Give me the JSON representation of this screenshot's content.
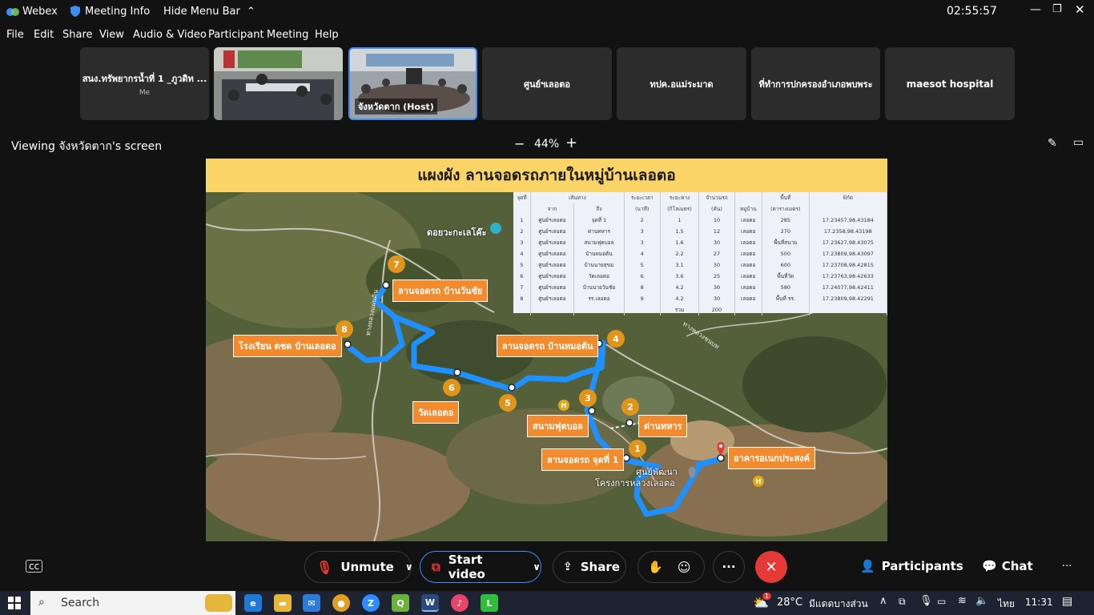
{
  "titlebar": {
    "app_name": "Webex",
    "meeting_info": "Meeting Info",
    "hide_menu": "Hide Menu Bar",
    "clock": "02:55:57"
  },
  "menu": [
    "File",
    "Edit",
    "Share",
    "View",
    "Audio & Video",
    "Participant",
    "Meeting",
    "Help"
  ],
  "participants": [
    {
      "name": "สนง.ทรัพยากรน้ำที่ 1 _ภูวดิท ...",
      "sub": "Me",
      "video": false
    },
    {
      "name": "",
      "sub": "",
      "video": true
    },
    {
      "name": "จังหวัดตาก (Host)",
      "sub": "",
      "video": true
    },
    {
      "name": "ศูนย์ฯเลอตอ",
      "sub": "",
      "video": false
    },
    {
      "name": "ทปค.อแม่ระมาด",
      "sub": "",
      "video": false
    },
    {
      "name": "ที่ทำการปกครองอำเภอพบพระ",
      "sub": "",
      "video": false
    },
    {
      "name": "maesot hospital",
      "sub": "",
      "video": false
    }
  ],
  "viewing": {
    "text": "Viewing จังหวัดตาก's screen",
    "zoom": "44%",
    "minus": "−",
    "plus": "+"
  },
  "slide": {
    "title": "แผงผัง ลานจอดรถภายในหมู่บ้านเลอตอ",
    "place_label": "ดอยวะกะเลโค๊ะ",
    "road_labels": [
      "ทางหลวงแผ่นดิน",
      "ทางหลวงชนบท"
    ],
    "table": {
      "headers": [
        "จุดที่",
        "เส้นทาง",
        "ระยะเวลา",
        "ระยะทาง",
        "จำนวนรถ",
        "หมู่บ้าน",
        "พื้นที่",
        "พิกัด"
      ],
      "subheaders": [
        "",
        "จาก",
        "ถึง",
        "(นาที)",
        "(กิโลเมตร)",
        "(คัน)",
        "",
        "(ตารางเมตร)",
        ""
      ],
      "rows": [
        [
          "1",
          "ศูนย์ฯเลอตอ",
          "จุดที่ 1",
          "2",
          "1",
          "10",
          "เลอตอ",
          "285",
          "17.23457,98.43184"
        ],
        [
          "2",
          "ศูนย์ฯเลอตอ",
          "ด่านทหาร",
          "3",
          "1.5",
          "12",
          "เลอตอ",
          "270",
          "17.2358,98.43198"
        ],
        [
          "3",
          "ศูนย์ฯเลอตอ",
          "สนามฟุตบอล",
          "3",
          "1.6",
          "30",
          "เลอตอ",
          "พื้นที่สนาม",
          "17.23627,98.43075"
        ],
        [
          "4",
          "ศูนย์ฯเลอตอ",
          "บ้านหมอต้น",
          "4",
          "2.2",
          "27",
          "เลอตอ",
          "500",
          "17.23809,98.43097"
        ],
        [
          "5",
          "ศูนย์ฯเลอตอ",
          "บ้านนายสุขม",
          "5",
          "3.1",
          "30",
          "เลอตอ",
          "600",
          "17.23708,98.42815"
        ],
        [
          "6",
          "ศูนย์ฯเลอตอ",
          "วัดเลอตอ",
          "6",
          "3.6",
          "25",
          "เลอตอ",
          "พื้นที่วัด",
          "17.23763,98.42633"
        ],
        [
          "7",
          "ศูนย์ฯเลอตอ",
          "บ้านนายวันชัย",
          "8",
          "4.2",
          "30",
          "เลอตอ",
          "580",
          "17.24077,98.42411"
        ],
        [
          "8",
          "ศูนย์ฯเลอตอ",
          "รร.เลอตอ",
          "9",
          "4.2",
          "30",
          "เลอตอ",
          "พื้นที่ รร.",
          "17.23809,98.42291"
        ]
      ],
      "total_label": "รวม",
      "total_value": "200"
    },
    "labels": {
      "l7": "ลานจอดรถ บ้านวันชัย",
      "l8": "โรงเรียน ตชด บ้านเลอตอ",
      "l4": "ลานจอดรถ บ้านหมอต้น",
      "l6": "วัดเลอตอ",
      "l3": "สนามฟุตบอล",
      "l2": "ด่านทหาร",
      "l1": "ลานจอดรถ จุดที่ 1",
      "l0": "อาคารอเนกประสงค์",
      "center1": "ศูนย์พัฒนา",
      "center2": "โครงการหลวงเลอตอ"
    },
    "pins": [
      "1",
      "2",
      "3",
      "4",
      "5",
      "6",
      "7",
      "8"
    ],
    "hospital": "H"
  },
  "controls": {
    "unmute": "Unmute",
    "start_video": "Start video",
    "share": "Share",
    "participants": "Participants",
    "chat": "Chat",
    "more": "···"
  },
  "taskbar": {
    "search": "Search",
    "weather_temp": "28°C",
    "weather_desc": "มีแดดบางส่วน",
    "lang": "ไทย",
    "time": "11:31",
    "badge": "1"
  },
  "colors": {
    "accent_blue": "#3d8ef7",
    "route_blue": "#1e90ff",
    "end_call_red": "#e53935",
    "banner": "#fbd467",
    "label_orange": "#f28a2e"
  }
}
